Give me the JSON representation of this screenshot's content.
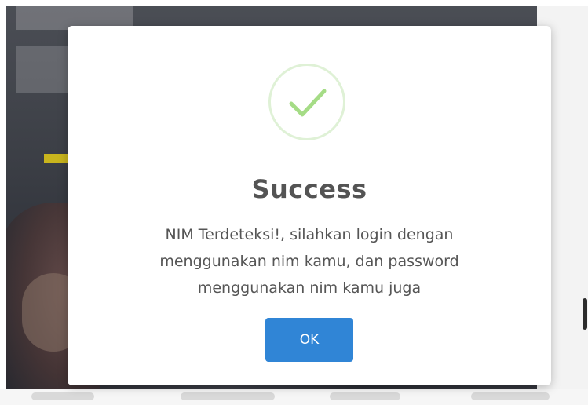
{
  "dialog": {
    "icon": "checkmark-success-icon",
    "title": "Success",
    "message": "NIM Terdeteksi!, silahkan login dengan menggunakan nim kamu, dan password menggunakan nim kamu juga",
    "ok_label": "OK"
  },
  "colors": {
    "success_green": "#a5dc86",
    "success_ring": "#dff1d6",
    "button_blue": "#3085d6",
    "title_text": "#545454",
    "body_text": "#555555"
  }
}
